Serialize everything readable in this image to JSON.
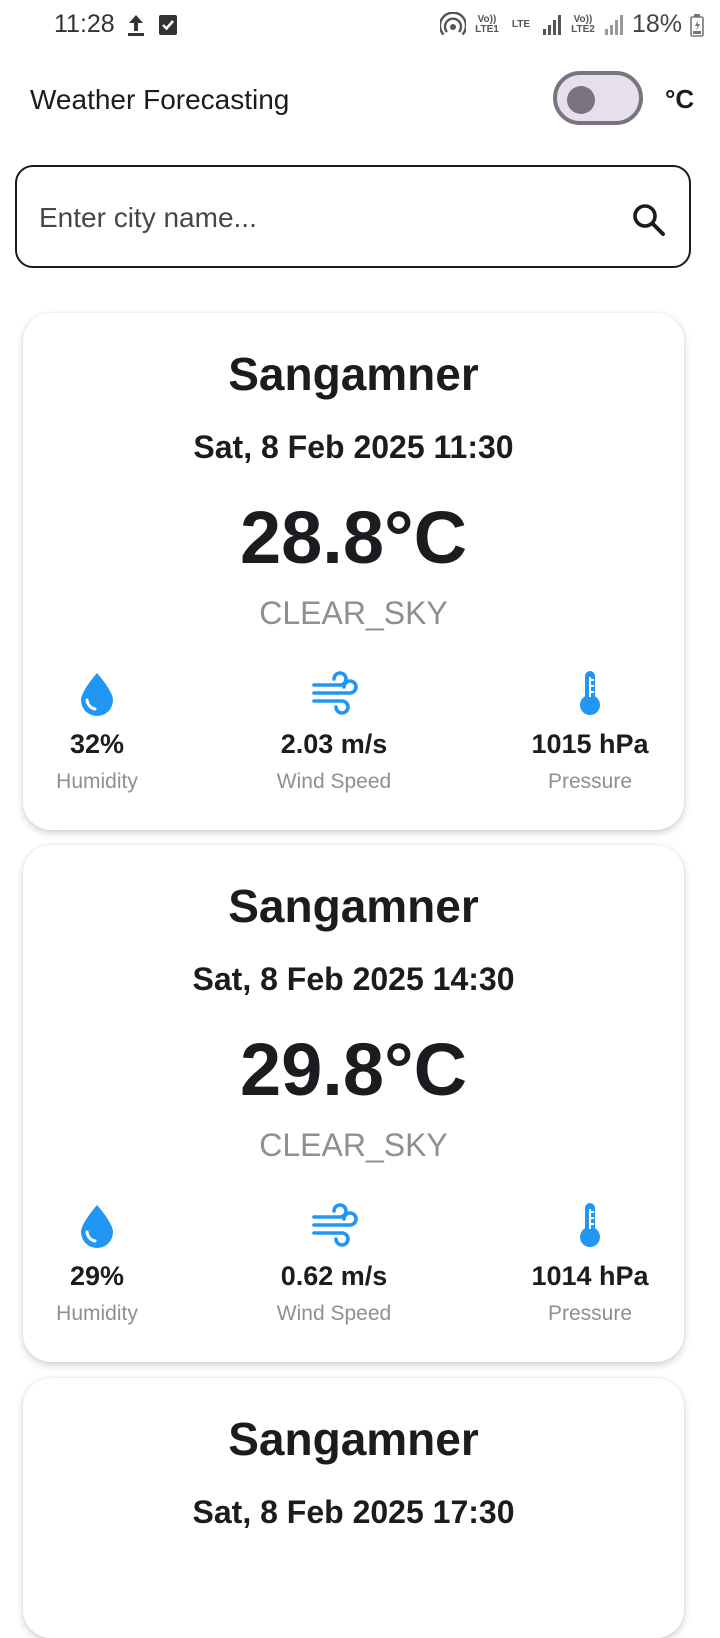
{
  "status_bar": {
    "time": "11:28",
    "signal1_label": "Vo)) LTE1",
    "net_label": "LTE",
    "signal2_label": "Vo)) LTE2",
    "battery": "18%"
  },
  "header": {
    "title": "Weather Forecasting",
    "unit_label": "°C",
    "toggle_on": false
  },
  "search": {
    "placeholder": "Enter city name...",
    "value": ""
  },
  "colors": {
    "accent": "#2196f3",
    "muted_text": "#8f8f8f",
    "outline": "#79747e"
  },
  "forecasts": [
    {
      "city": "Sangamner",
      "datetime": "Sat, 8 Feb 2025 11:30",
      "temp": "28.8°C",
      "condition": "CLEAR_SKY",
      "humidity_value": "32%",
      "humidity_label": "Humidity",
      "wind_value": "2.03 m/s",
      "wind_label": "Wind Speed",
      "pressure_value": "1015 hPa",
      "pressure_label": "Pressure"
    },
    {
      "city": "Sangamner",
      "datetime": "Sat, 8 Feb 2025 14:30",
      "temp": "29.8°C",
      "condition": "CLEAR_SKY",
      "humidity_value": "29%",
      "humidity_label": "Humidity",
      "wind_value": "0.62 m/s",
      "wind_label": "Wind Speed",
      "pressure_value": "1014 hPa",
      "pressure_label": "Pressure"
    },
    {
      "city": "Sangamner",
      "datetime": "Sat, 8 Feb 2025 17:30"
    }
  ]
}
